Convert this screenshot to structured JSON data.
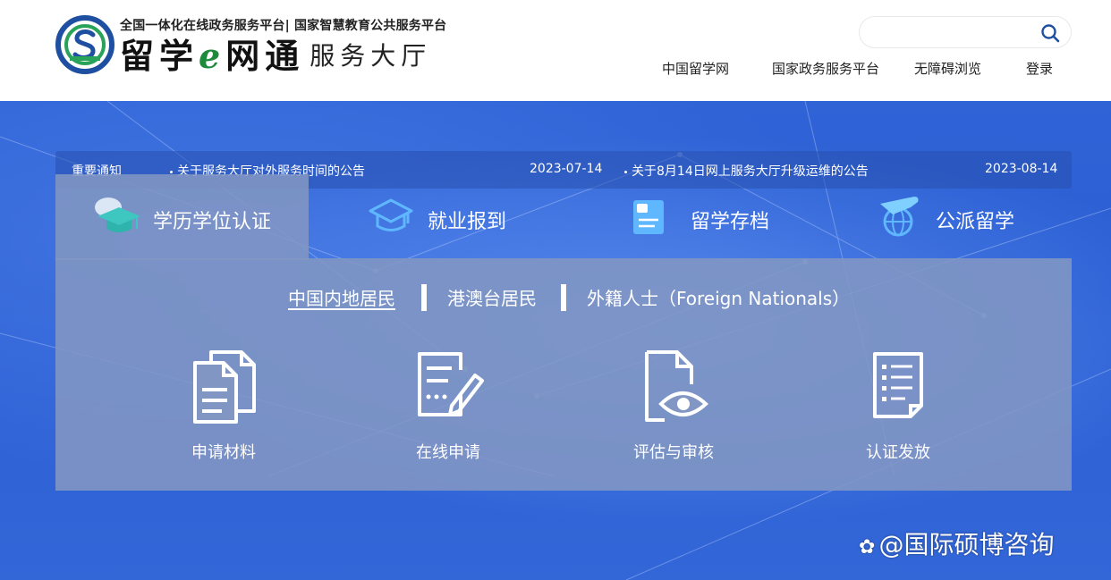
{
  "header": {
    "tagline": "全国一体化在线政务服务平台| 国家智慧教育公共服务平台",
    "brand_part1": "留学",
    "brand_e": "e",
    "brand_part2": "网通",
    "brand_sub": "服务大厅",
    "search": {
      "value": "",
      "placeholder": ""
    },
    "nav": [
      "中国留学网",
      "国家政务服务平台",
      "无障碍浏览",
      "登录"
    ]
  },
  "notice": {
    "label": "重要通知",
    "items": [
      {
        "title": "关于服务大厅对外服务时间的公告",
        "date": "2023-07-14"
      },
      {
        "title": "关于8月14日网上服务大厅升级运维的公告",
        "date": "2023-08-14"
      }
    ]
  },
  "tabs": [
    {
      "label": "学历学位认证",
      "icon": "graduation-cap-icon",
      "active": true
    },
    {
      "label": "就业报到",
      "icon": "mortarboard-outline-icon",
      "active": false
    },
    {
      "label": "留学存档",
      "icon": "archive-folder-icon",
      "active": false
    },
    {
      "label": "公派留学",
      "icon": "plane-globe-icon",
      "active": false
    }
  ],
  "subtabs": [
    {
      "label": "中国内地居民",
      "active": true
    },
    {
      "label": "港澳台居民",
      "active": false
    },
    {
      "label": "外籍人士（Foreign Nationals）",
      "active": false
    }
  ],
  "services": [
    {
      "label": "申请材料",
      "icon": "documents-icon"
    },
    {
      "label": "在线申请",
      "icon": "form-edit-icon"
    },
    {
      "label": "评估与审核",
      "icon": "document-eye-icon"
    },
    {
      "label": "认证发放",
      "icon": "checklist-icon"
    }
  ],
  "watermark": {
    "text": "@国际硕博咨询"
  },
  "colors": {
    "banner_blue": "#2f63d6",
    "panel": "#8296c3",
    "brand_green": "#1d8a3c",
    "logo_blue": "#1f4fa0"
  }
}
